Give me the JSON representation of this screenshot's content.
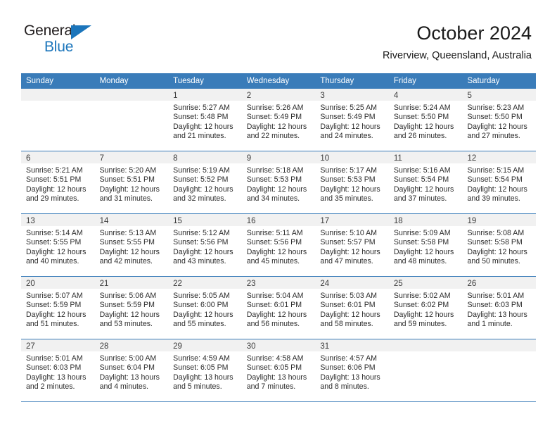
{
  "logo": {
    "word_top": "General",
    "word_bottom": "Blue",
    "triangle_icon": "triangle-icon",
    "color_dark": "#231f20",
    "color_blue": "#1b75bb"
  },
  "header": {
    "title": "October 2024",
    "subtitle": "Riverview, Queensland, Australia"
  },
  "theme": {
    "header_blue": "#3a7cb9",
    "day_band_gray": "#f1f1f1",
    "text_dark": "#2b2b2b"
  },
  "calendar": {
    "weekdays": [
      "Sunday",
      "Monday",
      "Tuesday",
      "Wednesday",
      "Thursday",
      "Friday",
      "Saturday"
    ],
    "weeks": [
      [
        {
          "day": "",
          "lines": []
        },
        {
          "day": "",
          "lines": []
        },
        {
          "day": "1",
          "lines": [
            "Sunrise: 5:27 AM",
            "Sunset: 5:48 PM",
            "Daylight: 12 hours",
            "and 21 minutes."
          ]
        },
        {
          "day": "2",
          "lines": [
            "Sunrise: 5:26 AM",
            "Sunset: 5:49 PM",
            "Daylight: 12 hours",
            "and 22 minutes."
          ]
        },
        {
          "day": "3",
          "lines": [
            "Sunrise: 5:25 AM",
            "Sunset: 5:49 PM",
            "Daylight: 12 hours",
            "and 24 minutes."
          ]
        },
        {
          "day": "4",
          "lines": [
            "Sunrise: 5:24 AM",
            "Sunset: 5:50 PM",
            "Daylight: 12 hours",
            "and 26 minutes."
          ]
        },
        {
          "day": "5",
          "lines": [
            "Sunrise: 5:23 AM",
            "Sunset: 5:50 PM",
            "Daylight: 12 hours",
            "and 27 minutes."
          ]
        }
      ],
      [
        {
          "day": "6",
          "lines": [
            "Sunrise: 5:21 AM",
            "Sunset: 5:51 PM",
            "Daylight: 12 hours",
            "and 29 minutes."
          ]
        },
        {
          "day": "7",
          "lines": [
            "Sunrise: 5:20 AM",
            "Sunset: 5:51 PM",
            "Daylight: 12 hours",
            "and 31 minutes."
          ]
        },
        {
          "day": "8",
          "lines": [
            "Sunrise: 5:19 AM",
            "Sunset: 5:52 PM",
            "Daylight: 12 hours",
            "and 32 minutes."
          ]
        },
        {
          "day": "9",
          "lines": [
            "Sunrise: 5:18 AM",
            "Sunset: 5:53 PM",
            "Daylight: 12 hours",
            "and 34 minutes."
          ]
        },
        {
          "day": "10",
          "lines": [
            "Sunrise: 5:17 AM",
            "Sunset: 5:53 PM",
            "Daylight: 12 hours",
            "and 35 minutes."
          ]
        },
        {
          "day": "11",
          "lines": [
            "Sunrise: 5:16 AM",
            "Sunset: 5:54 PM",
            "Daylight: 12 hours",
            "and 37 minutes."
          ]
        },
        {
          "day": "12",
          "lines": [
            "Sunrise: 5:15 AM",
            "Sunset: 5:54 PM",
            "Daylight: 12 hours",
            "and 39 minutes."
          ]
        }
      ],
      [
        {
          "day": "13",
          "lines": [
            "Sunrise: 5:14 AM",
            "Sunset: 5:55 PM",
            "Daylight: 12 hours",
            "and 40 minutes."
          ]
        },
        {
          "day": "14",
          "lines": [
            "Sunrise: 5:13 AM",
            "Sunset: 5:55 PM",
            "Daylight: 12 hours",
            "and 42 minutes."
          ]
        },
        {
          "day": "15",
          "lines": [
            "Sunrise: 5:12 AM",
            "Sunset: 5:56 PM",
            "Daylight: 12 hours",
            "and 43 minutes."
          ]
        },
        {
          "day": "16",
          "lines": [
            "Sunrise: 5:11 AM",
            "Sunset: 5:56 PM",
            "Daylight: 12 hours",
            "and 45 minutes."
          ]
        },
        {
          "day": "17",
          "lines": [
            "Sunrise: 5:10 AM",
            "Sunset: 5:57 PM",
            "Daylight: 12 hours",
            "and 47 minutes."
          ]
        },
        {
          "day": "18",
          "lines": [
            "Sunrise: 5:09 AM",
            "Sunset: 5:58 PM",
            "Daylight: 12 hours",
            "and 48 minutes."
          ]
        },
        {
          "day": "19",
          "lines": [
            "Sunrise: 5:08 AM",
            "Sunset: 5:58 PM",
            "Daylight: 12 hours",
            "and 50 minutes."
          ]
        }
      ],
      [
        {
          "day": "20",
          "lines": [
            "Sunrise: 5:07 AM",
            "Sunset: 5:59 PM",
            "Daylight: 12 hours",
            "and 51 minutes."
          ]
        },
        {
          "day": "21",
          "lines": [
            "Sunrise: 5:06 AM",
            "Sunset: 5:59 PM",
            "Daylight: 12 hours",
            "and 53 minutes."
          ]
        },
        {
          "day": "22",
          "lines": [
            "Sunrise: 5:05 AM",
            "Sunset: 6:00 PM",
            "Daylight: 12 hours",
            "and 55 minutes."
          ]
        },
        {
          "day": "23",
          "lines": [
            "Sunrise: 5:04 AM",
            "Sunset: 6:01 PM",
            "Daylight: 12 hours",
            "and 56 minutes."
          ]
        },
        {
          "day": "24",
          "lines": [
            "Sunrise: 5:03 AM",
            "Sunset: 6:01 PM",
            "Daylight: 12 hours",
            "and 58 minutes."
          ]
        },
        {
          "day": "25",
          "lines": [
            "Sunrise: 5:02 AM",
            "Sunset: 6:02 PM",
            "Daylight: 12 hours",
            "and 59 minutes."
          ]
        },
        {
          "day": "26",
          "lines": [
            "Sunrise: 5:01 AM",
            "Sunset: 6:03 PM",
            "Daylight: 13 hours",
            "and 1 minute."
          ]
        }
      ],
      [
        {
          "day": "27",
          "lines": [
            "Sunrise: 5:01 AM",
            "Sunset: 6:03 PM",
            "Daylight: 13 hours",
            "and 2 minutes."
          ]
        },
        {
          "day": "28",
          "lines": [
            "Sunrise: 5:00 AM",
            "Sunset: 6:04 PM",
            "Daylight: 13 hours",
            "and 4 minutes."
          ]
        },
        {
          "day": "29",
          "lines": [
            "Sunrise: 4:59 AM",
            "Sunset: 6:05 PM",
            "Daylight: 13 hours",
            "and 5 minutes."
          ]
        },
        {
          "day": "30",
          "lines": [
            "Sunrise: 4:58 AM",
            "Sunset: 6:05 PM",
            "Daylight: 13 hours",
            "and 7 minutes."
          ]
        },
        {
          "day": "31",
          "lines": [
            "Sunrise: 4:57 AM",
            "Sunset: 6:06 PM",
            "Daylight: 13 hours",
            "and 8 minutes."
          ]
        },
        {
          "day": "",
          "lines": []
        },
        {
          "day": "",
          "lines": []
        }
      ]
    ]
  }
}
